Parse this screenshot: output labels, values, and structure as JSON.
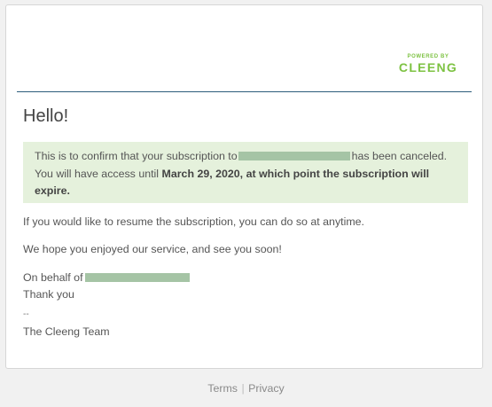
{
  "brand": {
    "powered_by": "POWERED BY",
    "logo": "CLEENG"
  },
  "email": {
    "greeting": "Hello!",
    "notice": {
      "prefix": "This is to confirm that your subscription to",
      "suffix": "has been canceled.",
      "access_text": "You will have access until",
      "date_text": "March 29, 2020, at which point the subscription will expire."
    },
    "resume_text": "If you would like to resume the subscription, you can do so at anytime.",
    "hope_text": "We hope you enjoyed our service, and see you soon!",
    "behalf_text": "On behalf of",
    "thanks_text": "Thank you",
    "signature_dash": "--",
    "signature": "The Cleeng Team"
  },
  "footer": {
    "terms": "Terms",
    "separator": "|",
    "privacy": "Privacy"
  },
  "colors": {
    "brand_green": "#7dc242",
    "notice_bg": "#e5f1dc",
    "divider": "#2d5d7b",
    "redaction": "#a5c4a5"
  }
}
